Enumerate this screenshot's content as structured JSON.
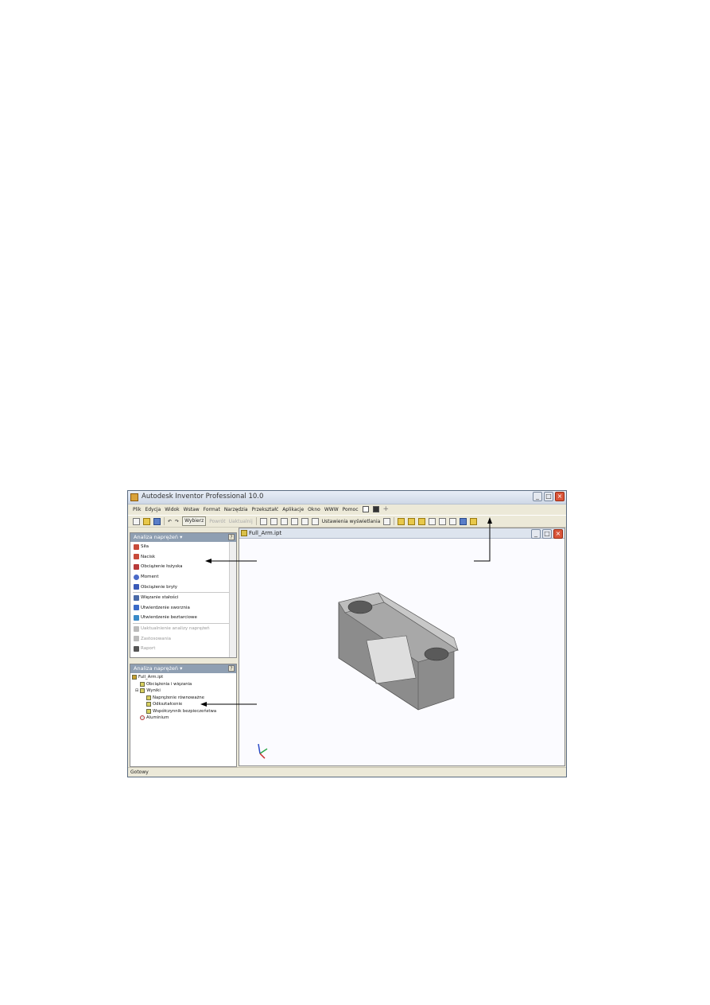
{
  "window": {
    "title": "Autodesk Inventor Professional 10.0",
    "menu": [
      "Plik",
      "Edycja",
      "Widok",
      "Wstaw",
      "Format",
      "Narzędzia",
      "Przekształć",
      "Aplikacje",
      "Okno",
      "WWW",
      "Pomoc"
    ],
    "status": "Gotowy"
  },
  "toolbar": {
    "select_label": "Wybierz",
    "return_label": "Powrót",
    "update_label": "Uaktualnij",
    "display_settings_label": "Ustawienia wyświetlania"
  },
  "panel_top": {
    "title": "Analiza naprężeń",
    "items": [
      "Siła",
      "Nacisk",
      "Obciążenie łożyska",
      "Moment",
      "Obciążenie bryły"
    ],
    "constraints": [
      "Więzanie stałości",
      "Utwierdzenie sworznia",
      "Utwierdzenie beztarciowe"
    ],
    "disabled": [
      "Uaktualnienie analizy naprężeń",
      "Zastosowania",
      "Raport"
    ]
  },
  "panel_bottom": {
    "title": "Analiza naprężeń",
    "tree": [
      "Full_Arm.ipt",
      "Obciążenia i więzania",
      "Wyniki",
      "Naprężenie równoważne",
      "Odkształcenie",
      "Współczynnik bezpieczeństwa",
      "Aluminium"
    ]
  },
  "document": {
    "title": "Full_Arm.ipt"
  },
  "colors": {
    "panel_header": "#8f9fb2",
    "title_gradient": "#cfd8e6",
    "close_button": "#d9553a"
  }
}
